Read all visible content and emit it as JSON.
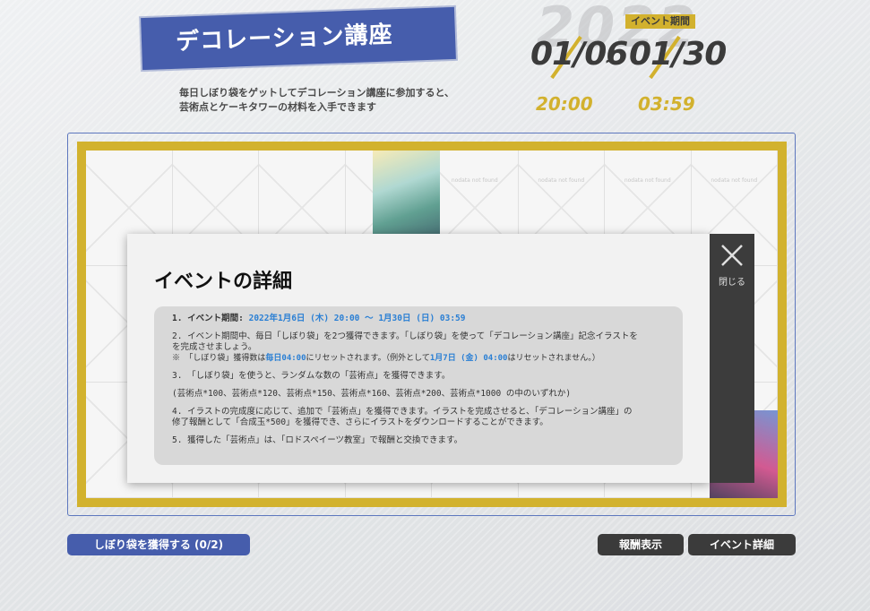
{
  "header": {
    "title": "デコレーション講座",
    "subtitle_line1": "毎日しぼり袋をゲットしてデコレーション講座に参加すると、",
    "subtitle_line2": "芸術点とケーキタワーの材料を入手できます",
    "year_watermark": "2022",
    "period_label": "イベント期間",
    "start_date": "01/06",
    "end_date": "01/30",
    "tilde": "~",
    "start_time": "20:00",
    "end_time": "03:59"
  },
  "board": {
    "cell_placeholder": "nodata not found"
  },
  "buttons": {
    "gacha": "しぼり袋を獲得する (0/2)",
    "reward": "報酬表示",
    "detail": "イベント詳細"
  },
  "modal": {
    "title": "イベントの詳細",
    "close_label": "閉じる",
    "item1_prefix": "1. イベント期間: ",
    "item1_value": "2022年1月6日 (木) 20:00 ～ 1月30日 (日) 03:59",
    "item2_line1": "2. イベント期間中、毎日「しぼり袋」を2つ獲得できます。「しぼり袋」を使って「デコレーション講座」記念イラストを",
    "item2_line2": "を完成させましょう。",
    "item2_note_a": "※ 「しぼり袋」獲得数は",
    "item2_note_hl1": "毎日04:00",
    "item2_note_b": "にリセットされます。（例外として",
    "item2_note_hl2": "1月7日 (金) 04:00",
    "item2_note_c": "はリセットされません。）",
    "item3": "3. 「しぼり袋」を使うと、ランダムな数の「芸術点」を獲得できます。",
    "item3_options": "(芸術点*100、芸術点*120、芸術点*150、芸術点*160、芸術点*200、芸術点*1000 の中のいずれか)",
    "item4_line1": "4. イラストの完成度に応じて、追加で「芸術点」を獲得できます。イラストを完成させると、「デコレーション講座」の",
    "item4_line2": "修了報酬として「合成玉*500」を獲得でき、さらにイラストをダウンロードすることができます。",
    "item5": "5. 獲得した「芸術点」は、「ロドスペイーツ教室」で報酬と交換できます。"
  },
  "colors": {
    "accent_blue": "#1e3a9a",
    "accent_gold": "#c9a200",
    "highlight_link": "#2a7fd4"
  }
}
